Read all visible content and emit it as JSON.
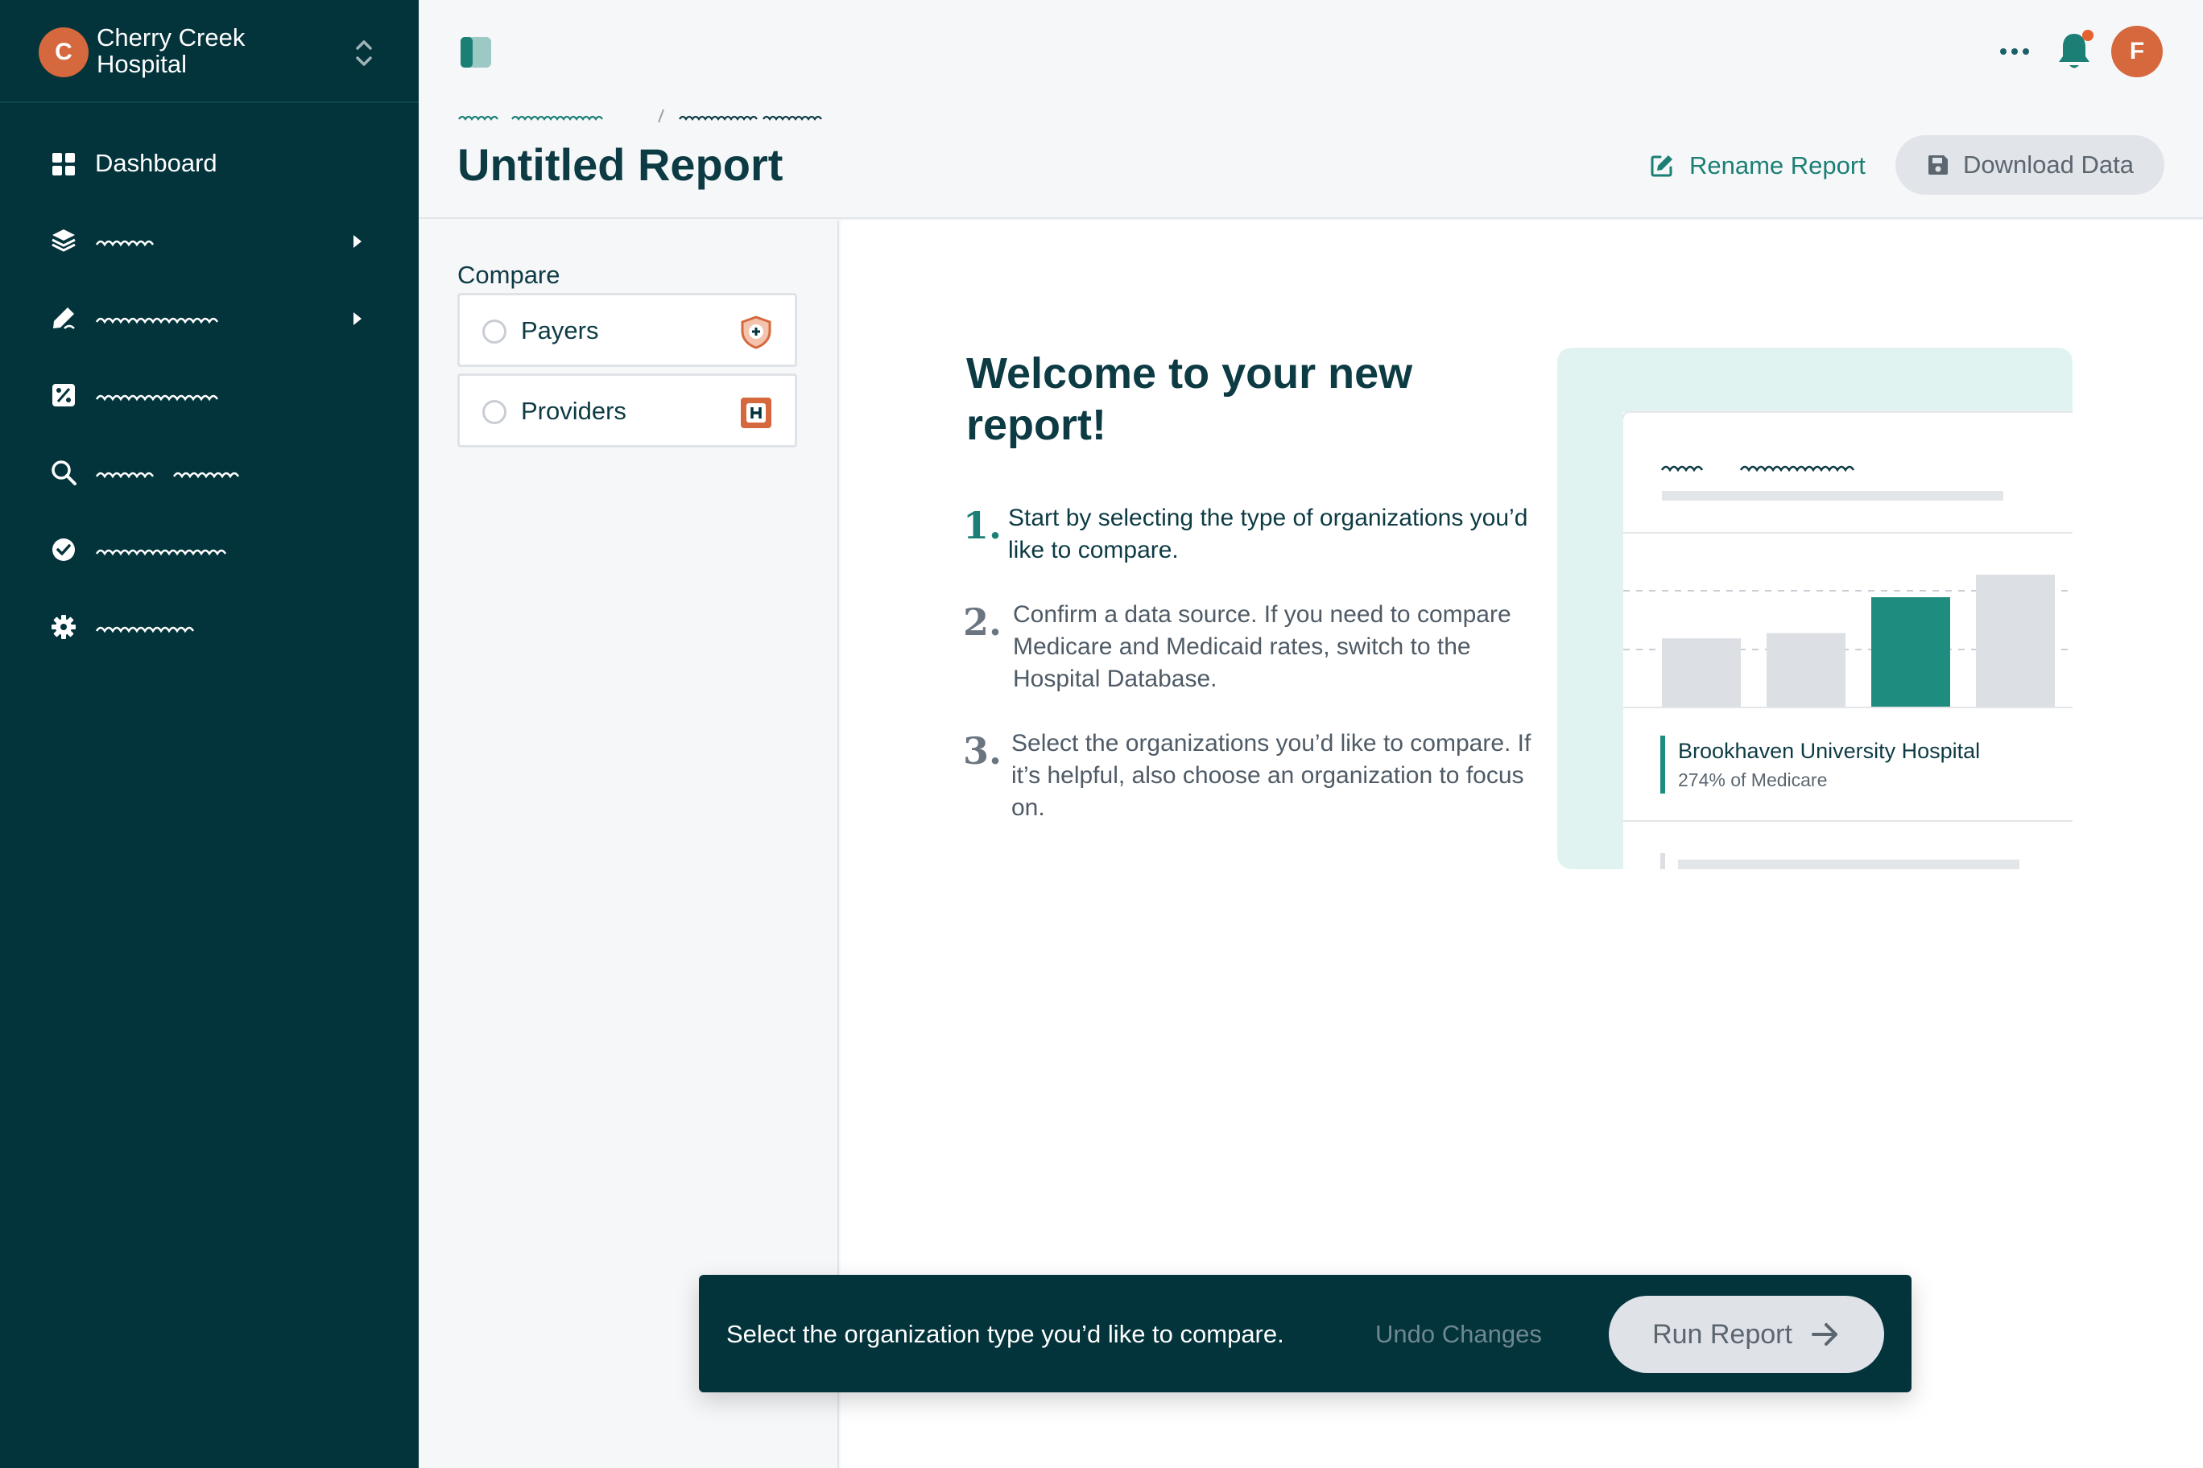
{
  "org": {
    "initial": "C",
    "name": "Cherry Creek Hospital"
  },
  "user": {
    "initial": "F"
  },
  "nav": {
    "dashboard": "Dashboard"
  },
  "header": {
    "title": "Untitled Report",
    "rename_label": "Rename Report",
    "download_label": "Download Data"
  },
  "compare": {
    "label": "Compare",
    "options": [
      {
        "label": "Payers"
      },
      {
        "label": "Providers"
      }
    ]
  },
  "welcome": {
    "title": "Welcome to your new report!",
    "steps": [
      {
        "num": "1.",
        "text": "Start by selecting the type of organizations you’d like to compare."
      },
      {
        "num": "2.",
        "text": "Confirm a data source. If you need to compare Medicare and Medicaid rates, switch to the Hospital Database."
      },
      {
        "num": "3.",
        "text": "Select the organizations you’d like to compare. If it’s helpful, also choose an organization to focus on."
      }
    ]
  },
  "illustration": {
    "hospital_name": "Brookhaven University Hospital",
    "hospital_rate": "274% of Medicare",
    "bars": [
      {
        "value": 0.52,
        "highlight": false
      },
      {
        "value": 0.56,
        "highlight": false
      },
      {
        "value": 0.83,
        "highlight": true
      },
      {
        "value": 1.0,
        "highlight": false
      }
    ]
  },
  "action_bar": {
    "message": "Select the organization type you’d like to compare.",
    "undo_label": "Undo Changes",
    "run_label": "Run Report"
  },
  "colors": {
    "sidebar": "#03333b",
    "accent": "#1b7f75",
    "orange": "#d5683d",
    "bar_highlight": "#1f8c80",
    "bar_default": "#dcdfe3"
  }
}
